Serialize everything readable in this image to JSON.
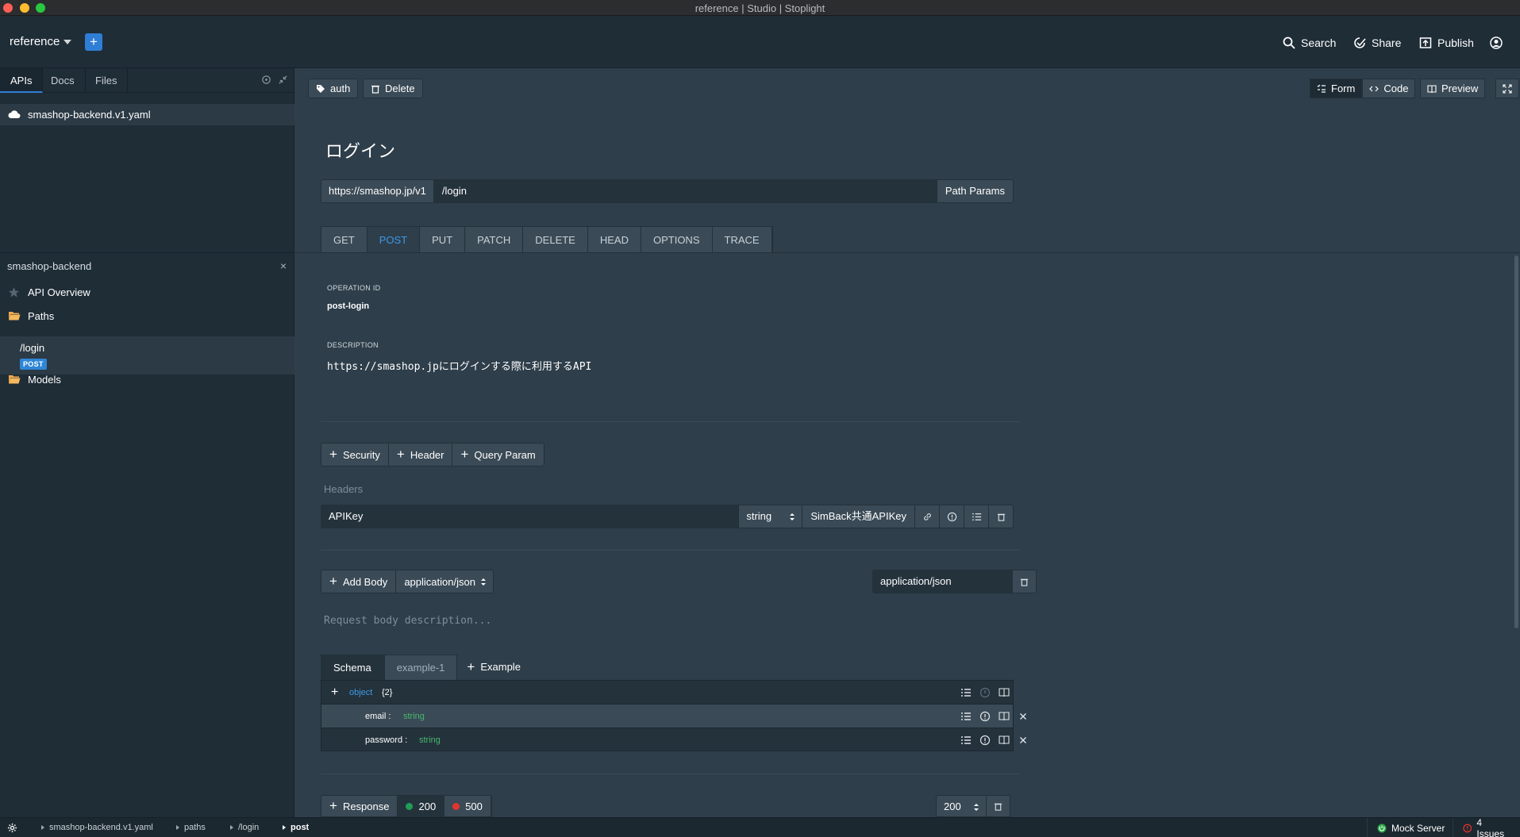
{
  "window": {
    "title": "reference | Studio | Stoplight"
  },
  "topbar": {
    "project": "reference",
    "add_label": "+",
    "actions": [
      {
        "label": "Search",
        "icon": "search-icon"
      },
      {
        "label": "Share",
        "icon": "share-icon"
      },
      {
        "label": "Publish",
        "icon": "publish-icon"
      }
    ]
  },
  "sidebar": {
    "tabs": [
      "APIs",
      "Docs",
      "Files"
    ],
    "active_tab": "APIs",
    "file": "smashop-backend.v1.yaml",
    "project_panel": {
      "title": "smashop-backend",
      "close": "×",
      "items": [
        {
          "label": "API Overview",
          "icon": "star-icon"
        },
        {
          "label": "Paths",
          "icon": "folder-icon"
        },
        {
          "label": "Models",
          "icon": "folder-icon"
        }
      ],
      "path": {
        "label": "/login",
        "method": "POST"
      }
    }
  },
  "toolbar": {
    "tag": "auth",
    "delete": "Delete",
    "views": [
      "Form",
      "Code"
    ],
    "active_view": "Form",
    "preview": "Preview"
  },
  "operation": {
    "title": "ログイン",
    "server": "https://smashop.jp/v1",
    "path": "/login",
    "path_params": "Path Params",
    "methods": [
      "GET",
      "POST",
      "PUT",
      "PATCH",
      "DELETE",
      "HEAD",
      "OPTIONS",
      "TRACE"
    ],
    "active_method": "POST",
    "operation_id_label": "OPERATION ID",
    "operation_id": "post-login",
    "description_label": "DESCRIPTION",
    "description": "https://smashop.jpにログインする際に利用するAPI"
  },
  "params": {
    "buttons": [
      "Security",
      "Header",
      "Query Param"
    ],
    "headers_label": "Headers",
    "header": {
      "name": "APIKey",
      "type": "string",
      "ref": "SimBack共通APIKey"
    }
  },
  "body": {
    "add_label": "Add Body",
    "content_type": "application/json",
    "content_type_value": "application/json",
    "description_placeholder": "Request body description...",
    "tabs": [
      "Schema",
      "example-1"
    ],
    "active_tab": "Schema",
    "add_example": "Example",
    "schema": {
      "root_type": "object",
      "root_count": "{2}",
      "fields": [
        {
          "name": "email",
          "type": "string"
        },
        {
          "name": "password",
          "type": "string"
        }
      ]
    }
  },
  "responses": {
    "add_label": "Response",
    "codes": [
      {
        "code": "200",
        "color": "#1f9d55"
      },
      {
        "code": "500",
        "color": "#e3342f"
      }
    ],
    "selected_code": "200"
  },
  "statusbar": {
    "breadcrumbs": [
      "smashop-backend.v1.yaml",
      "paths",
      "/login",
      "post"
    ],
    "mock_server": "Mock Server",
    "issues": "4 Issues"
  }
}
